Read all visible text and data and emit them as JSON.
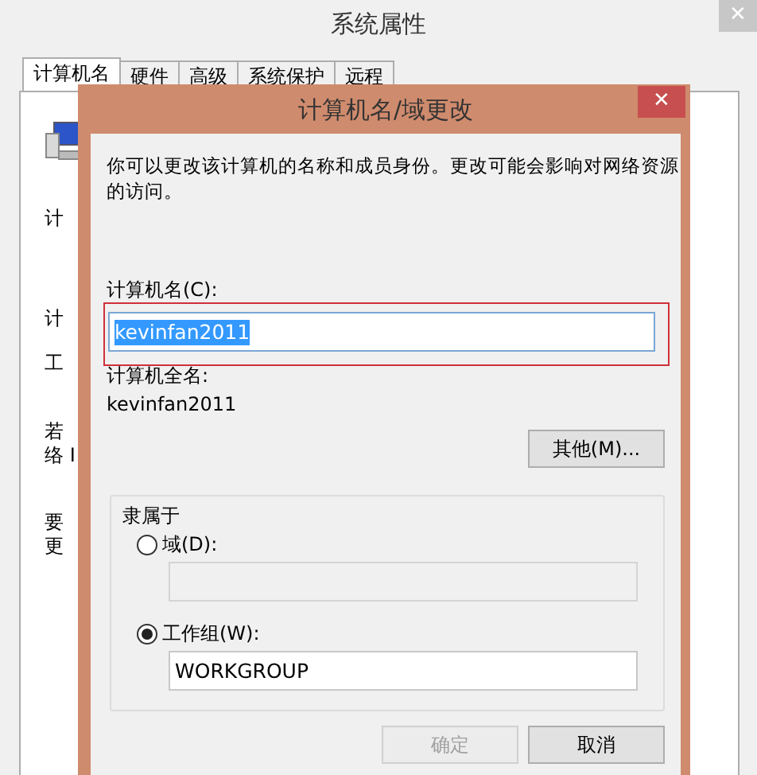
{
  "window": {
    "title": "系统属性",
    "close": "✕"
  },
  "tabs": [
    {
      "label": "计算机名",
      "selected": true
    },
    {
      "label": "硬件",
      "selected": false
    },
    {
      "label": "高级",
      "selected": false
    },
    {
      "label": "系统保护",
      "selected": false
    },
    {
      "label": "远程",
      "selected": false
    }
  ],
  "background_lines": [
    "计",
    "计",
    "工",
    "若",
    "络 I",
    "要",
    "更"
  ],
  "dialog": {
    "title": "计算机名/域更改",
    "close": "✕",
    "description": "你可以更改该计算机的名称和成员身份。更改可能会影响对网络资源的访问。",
    "computer_name": {
      "label": "计算机名(C):",
      "value": "kevinfan2011",
      "text_selected": true,
      "highlighted": true
    },
    "full_name": {
      "label": "计算机全名:",
      "value": "kevinfan2011"
    },
    "more_button": "其他(M)...",
    "member_of": {
      "legend": "隶属于",
      "options": [
        {
          "label": "域(D):",
          "selected": false
        },
        {
          "label": "工作组(W):",
          "selected": true,
          "value": "WORKGROUP"
        }
      ]
    },
    "buttons": [
      {
        "label": "确定",
        "disabled": true
      },
      {
        "label": "取消",
        "disabled": false
      }
    ]
  }
}
